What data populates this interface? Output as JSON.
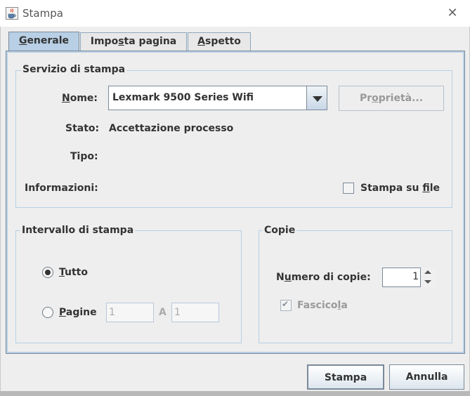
{
  "window": {
    "title": "Stampa",
    "close_symbol": "✕",
    "icon": "java-coffee-cup-icon"
  },
  "tabs": [
    {
      "label_pre": "",
      "label_ul": "G",
      "label_post": "enerale",
      "selected": true
    },
    {
      "label_pre": "Impo",
      "label_ul": "s",
      "label_post": "ta pagina",
      "selected": false
    },
    {
      "label_pre": "",
      "label_ul": "A",
      "label_post": "spetto",
      "selected": false
    }
  ],
  "service": {
    "group_title": "Servizio di stampa",
    "name_label_ul": "N",
    "name_label_post": "ome:",
    "printer_name": "Lexmark 9500 Series Wifi",
    "properties_pre": "Pr",
    "properties_ul": "o",
    "properties_post": "prietà...",
    "status_label": "Stato:",
    "status_value": "Accettazione processo",
    "type_label": "Tipo:",
    "info_label": "Informazioni:",
    "print_to_file_pre": "Stampa su ",
    "print_to_file_ul": "f",
    "print_to_file_post": "ile",
    "print_to_file_checked": false
  },
  "range": {
    "group_title": "Intervallo di stampa",
    "all_ul": "T",
    "all_post": "utto",
    "all_selected": true,
    "pages_ul": "P",
    "pages_post": "agine",
    "from_value": "1",
    "to_label": "A",
    "to_value": "1"
  },
  "copies": {
    "group_title": "Copie",
    "count_label_pre": "N",
    "count_label_ul": "u",
    "count_label_post": "mero di copie:",
    "count_value": "1",
    "collate_pre": "Fascico",
    "collate_ul": "l",
    "collate_post": "a",
    "collate_checked": true,
    "check_mark": "✔"
  },
  "footer": {
    "print_label": "Stampa",
    "cancel_label": "Annulla"
  }
}
